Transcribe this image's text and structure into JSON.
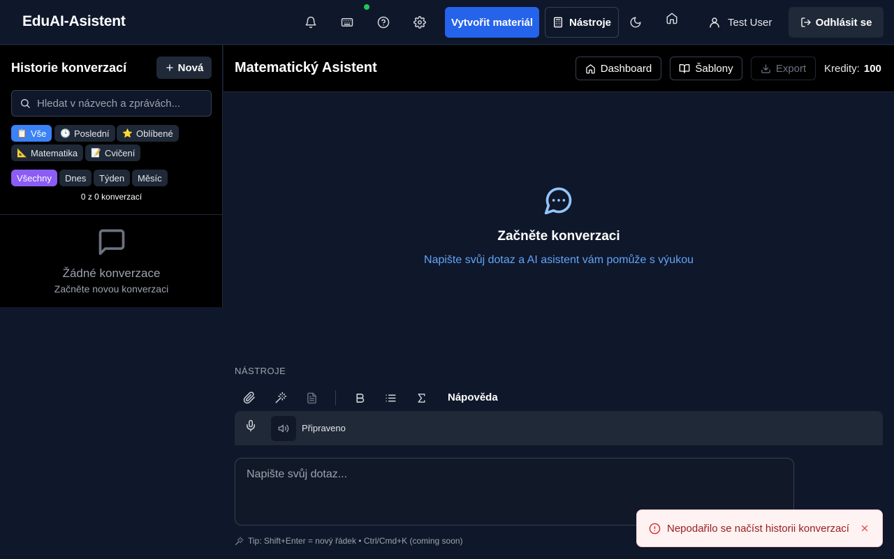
{
  "app": {
    "brand": "EduAI-Asistent",
    "create_label": "Vytvořit materiál",
    "tools_label": "Nástroje",
    "user_name": "Test User",
    "logout_label": "Odhlásit se"
  },
  "sidebar": {
    "title": "Historie konverzací",
    "new_label": "Nová",
    "search_placeholder": "Hledat v názvech a zprávách...",
    "categories": [
      {
        "emoji": "📋",
        "label": "Vše"
      },
      {
        "emoji": "🕒",
        "label": "Poslední"
      },
      {
        "emoji": "⭐",
        "label": "Oblíbené"
      },
      {
        "emoji": "📐",
        "label": "Matematika"
      },
      {
        "emoji": "📝",
        "label": "Cvičení"
      }
    ],
    "periods": [
      "Všechny",
      "Dnes",
      "Týden",
      "Měsíc"
    ],
    "count_text": "0 z 0 konverzací",
    "empty_title": "Žádné konverzace",
    "empty_sub": "Začněte novou konverzaci"
  },
  "main": {
    "title": "Matematický Asistent",
    "dashboard_label": "Dashboard",
    "templates_label": "Šablony",
    "export_label": "Export",
    "credits_label": "Kredity:",
    "credits_value": "100",
    "empty_title": "Začněte konverzaci",
    "empty_sub": "Napište svůj dotaz a AI asistent vám pomůže s výukou"
  },
  "tools": {
    "section_label": "NÁSTROJE",
    "help_label": "Nápověda",
    "voice_status": "Připraveno"
  },
  "composer": {
    "placeholder": "Napište svůj dotaz...",
    "tip": "Tip: Shift+Enter = nový řádek • Ctrl/Cmd+K (coming soon)"
  },
  "toast": {
    "message": "Nepodařilo se načíst historii konverzací"
  },
  "colors": {
    "accent": "#2563eb",
    "purple": "#8b5cf6",
    "online": "#22c55e",
    "error": "#991b1b"
  }
}
